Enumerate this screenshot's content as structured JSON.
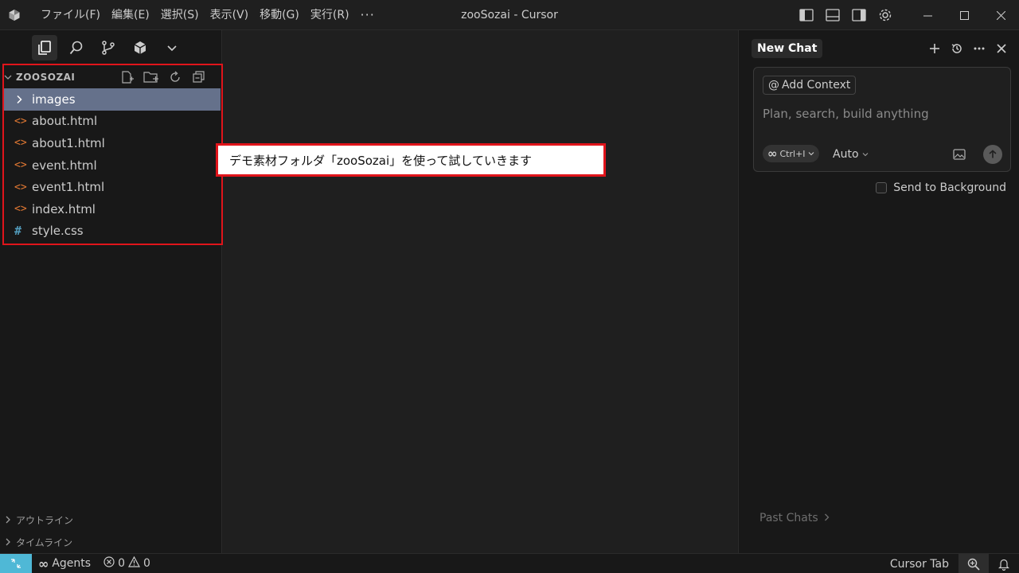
{
  "titlebar": {
    "menu": [
      {
        "label": "ファイル(F)"
      },
      {
        "label": "編集(E)"
      },
      {
        "label": "選択(S)"
      },
      {
        "label": "表示(V)"
      },
      {
        "label": "移動(G)"
      },
      {
        "label": "実行(R)"
      }
    ],
    "more_label": "···",
    "window_title": "zooSozai - Cursor"
  },
  "sidebar": {
    "explorer_title": "ZOOSOZAI",
    "files": [
      {
        "label": "images",
        "icon": "chevron-right-icon",
        "glyph": ">",
        "selected": true
      },
      {
        "label": "about.html",
        "icon": "html-file-icon",
        "glyph": "<>"
      },
      {
        "label": "about1.html",
        "icon": "html-file-icon",
        "glyph": "<>"
      },
      {
        "label": "event.html",
        "icon": "html-file-icon",
        "glyph": "<>"
      },
      {
        "label": "event1.html",
        "icon": "html-file-icon",
        "glyph": "<>"
      },
      {
        "label": "index.html",
        "icon": "html-file-icon",
        "glyph": "<>"
      },
      {
        "label": "style.css",
        "icon": "css-file-icon",
        "glyph": "#"
      }
    ],
    "outline_label": "アウトライン",
    "timeline_label": "タイムライン"
  },
  "callout": {
    "text": "デモ素材フォルダ「zooSozai」を使って試していきます"
  },
  "chat": {
    "tab_label": "New Chat",
    "add_context_label": "Add Context",
    "input_placeholder": "Plan, search, build anything",
    "mode_label": "Ctrl+I",
    "model_label": "Auto",
    "send_background_label": "Send to Background",
    "past_chats_label": "Past Chats"
  },
  "statusbar": {
    "agents_label": "Agents",
    "errors_count": "0",
    "warnings_count": "0",
    "cursor_tab_label": "Cursor Tab"
  },
  "colors": {
    "accent_red": "#e0141b",
    "html_icon": "#e37933",
    "css_icon": "#519aba",
    "remote": "#4fb8d6",
    "selection": "#65718b"
  }
}
